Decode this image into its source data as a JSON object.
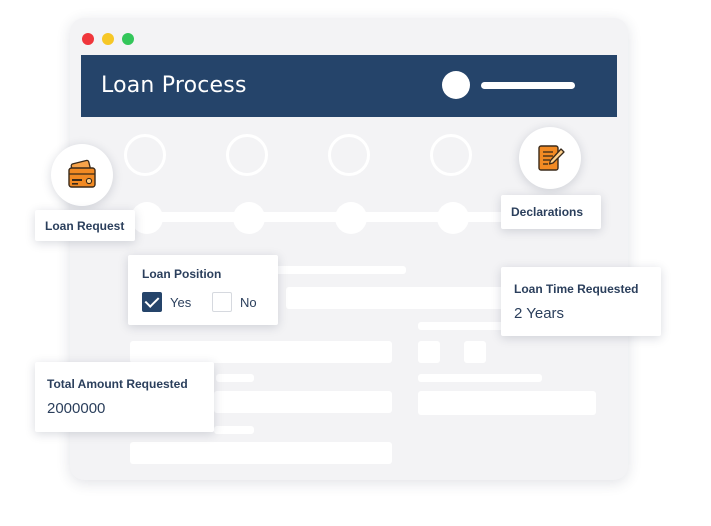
{
  "window": {
    "title": "Loan Process"
  },
  "steps": {
    "loan_request": {
      "label": "Loan Request",
      "icon": "wallet-card-icon"
    },
    "declarations": {
      "label": "Declarations",
      "icon": "document-pen-icon"
    }
  },
  "loan_position": {
    "label": "Loan Position",
    "options": [
      {
        "label": "Yes",
        "checked": true
      },
      {
        "label": "No",
        "checked": false
      }
    ]
  },
  "loan_time": {
    "label": "Loan Time Requested",
    "value": "2 Years"
  },
  "total_amount": {
    "label": "Total Amount Requested",
    "value": "2000000"
  },
  "colors": {
    "header": "#25446a",
    "accent_orange": "#f28a23",
    "window_bg": "#f3f3f5"
  }
}
